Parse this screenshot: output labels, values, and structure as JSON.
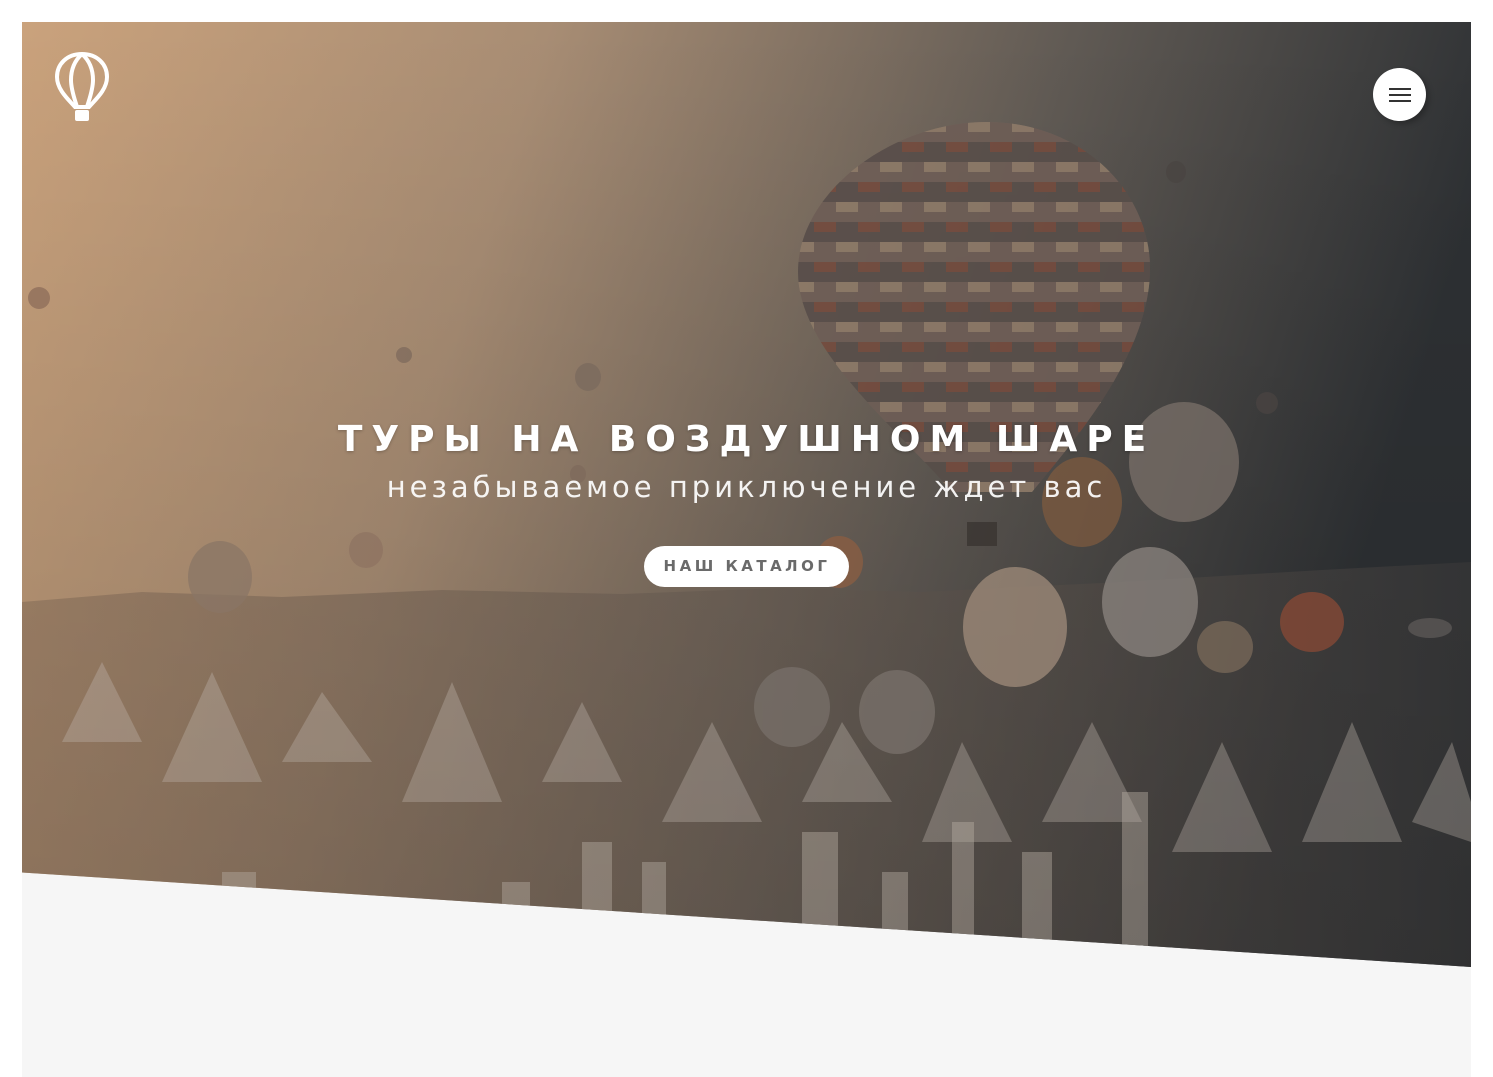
{
  "header": {
    "logo_icon": "hot-air-balloon-icon",
    "menu_icon": "hamburger-menu-icon"
  },
  "hero": {
    "title": "ТУРЫ НА ВОЗДУШНОМ ШАРЕ",
    "subtitle": "незабываемое приключение ждет вас",
    "button_label": "НАШ КАТАЛОГ"
  },
  "colors": {
    "overlay_left": "#c9a27e",
    "overlay_right": "#2f3235",
    "section_background": "#f6f6f6",
    "button_text": "#6a6a6a"
  }
}
